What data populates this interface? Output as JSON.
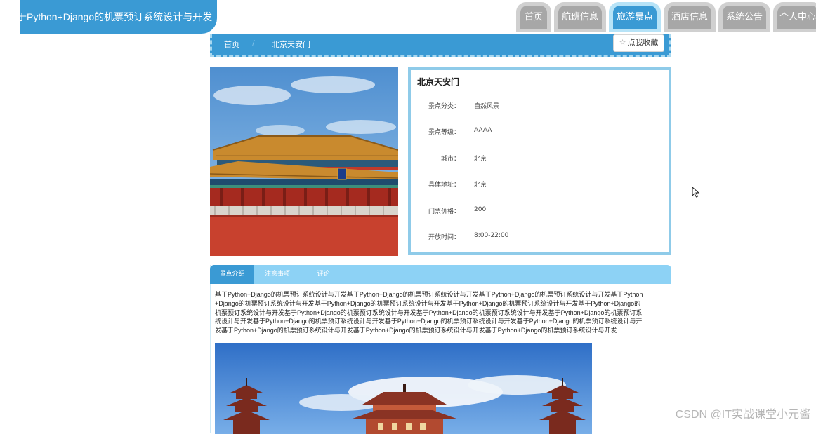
{
  "header": {
    "site_title": "基于Python+Django的机票预订系统设计与开发"
  },
  "nav": {
    "items": [
      {
        "label": "首页",
        "active": false
      },
      {
        "label": "航班信息",
        "active": false
      },
      {
        "label": "旅游景点",
        "active": true
      },
      {
        "label": "酒店信息",
        "active": false
      },
      {
        "label": "系统公告",
        "active": false
      },
      {
        "label": "个人中心",
        "active": false
      }
    ]
  },
  "breadcrumb": {
    "home": "首页",
    "separator": "/",
    "current": "北京天安门"
  },
  "favorite_button": {
    "label": "点我收藏",
    "icon": "star-outline-icon"
  },
  "attraction": {
    "name": "北京天安门",
    "fields": [
      {
        "label": "景点分类：",
        "value": "自然风景"
      },
      {
        "label": "景点等级：",
        "value": "AAAA"
      },
      {
        "label": "城市：",
        "value": "北京"
      },
      {
        "label": "具体地址：",
        "value": "北京"
      },
      {
        "label": "门票价格：",
        "value": "200"
      },
      {
        "label": "开放时间：",
        "value": "8:00-22:00"
      }
    ]
  },
  "tabs": {
    "items": [
      {
        "label": "景点介绍",
        "active": true
      },
      {
        "label": "注意事项",
        "active": false
      },
      {
        "label": "评论",
        "active": false
      }
    ],
    "intro_text": "基于Python+Django的机票预订系统设计与开发基于Python+Django的机票预订系统设计与开发基于Python+Django的机票预订系统设计与开发基于Python+Django的机票预订系统设计与开发基于Python+Django的机票预订系统设计与开发基于Python+Django的机票预订系统设计与开发基于Python+Django的机票预订系统设计与开发基于Python+Django的机票预订系统设计与开发基于Python+Django的机票预订系统设计与开发基于Python+Django的机票预订系统设计与开发基于Python+Django的机票预订系统设计与开发基于Python+Django的机票预订系统设计与开发基于Python+Django的机票预订系统设计与开发基于Python+Django的机票预订系统设计与开发基于Python+Django的机票预订系统设计与开发基于Python+Django的机票预订系统设计与开发"
  },
  "watermark": "CSDN @IT实战课堂小元酱",
  "colors": {
    "primary": "#3a9ad4",
    "tab_strip": "#8dd2f5",
    "panel_border": "#8fcbe9",
    "nav_inactive": "#a7a7a7"
  }
}
